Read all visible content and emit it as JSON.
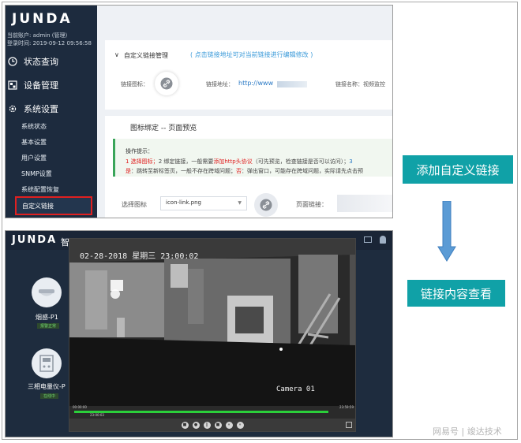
{
  "top": {
    "logo": "JUNDA",
    "account_line1": "当前账户: admin (管理)",
    "account_line2": "登录时间: 2019-09-12 09:56:58",
    "nav": [
      {
        "label": "状态查询",
        "icon": "clock-icon"
      },
      {
        "label": "设备管理",
        "icon": "device-icon"
      },
      {
        "label": "系统设置",
        "icon": "gear-icon"
      }
    ],
    "sub_items": [
      "系统状态",
      "基本设置",
      "用户设置",
      "SNMP设置",
      "系统配置恢复"
    ],
    "active_sub": "自定义链接",
    "panel_title": "自定义链接管理",
    "panel_hint": "( 点击链接地址可对当前链接进行编辑修改 )",
    "icon_label": "链接图标：",
    "address_label": "链接地址：",
    "address_value": "http://www",
    "name_label": "链接名称：视频监控",
    "binding_title": "图标绑定 -- 页面预览",
    "ops_title": "操作提示：",
    "ops_line1_a": "1 选择图标；",
    "ops_line1_b": "2 绑定链接，一般需要",
    "ops_line1_red": "添加http头协议",
    "ops_line1_c": "（可先预览，检查链接是否可以访问）；",
    "ops_line1_d": "3",
    "ops_line2_a": "是",
    "ops_line2_b": "：跳转至新标签页，一般不存在跨域问题；",
    "ops_line2_red": "否",
    "ops_line2_c": "：弹出窗口，可能存在跨域问题，实际请先点击预",
    "select_label": "选择图标",
    "select_value": "icon-link.png",
    "page_link_label": "页面链接："
  },
  "bottom": {
    "logo": "JUNDA",
    "title_char": "智",
    "devices": [
      {
        "label": "烟感-P1",
        "tag": "报警正常"
      },
      {
        "label": "三相电量仪-P",
        "tag": "在线中"
      }
    ],
    "video_timestamp": "02-28-2018 星期三 23:00:02",
    "camera_label": "Camera 01",
    "timeline_start": "00:00:00",
    "timeline_end": "23:59:59",
    "timeline_current": "23:00:03",
    "progress": 0.92
  },
  "callouts": {
    "add_link": "添加自定义链接",
    "view_link": "链接内容查看"
  },
  "watermark": "网易号 | 竣达技术",
  "colors": {
    "callout": "#10a1a7",
    "arrow": "#5b9bd5",
    "highlight_border": "#e02020",
    "sidebar": "#1d2b3e"
  }
}
